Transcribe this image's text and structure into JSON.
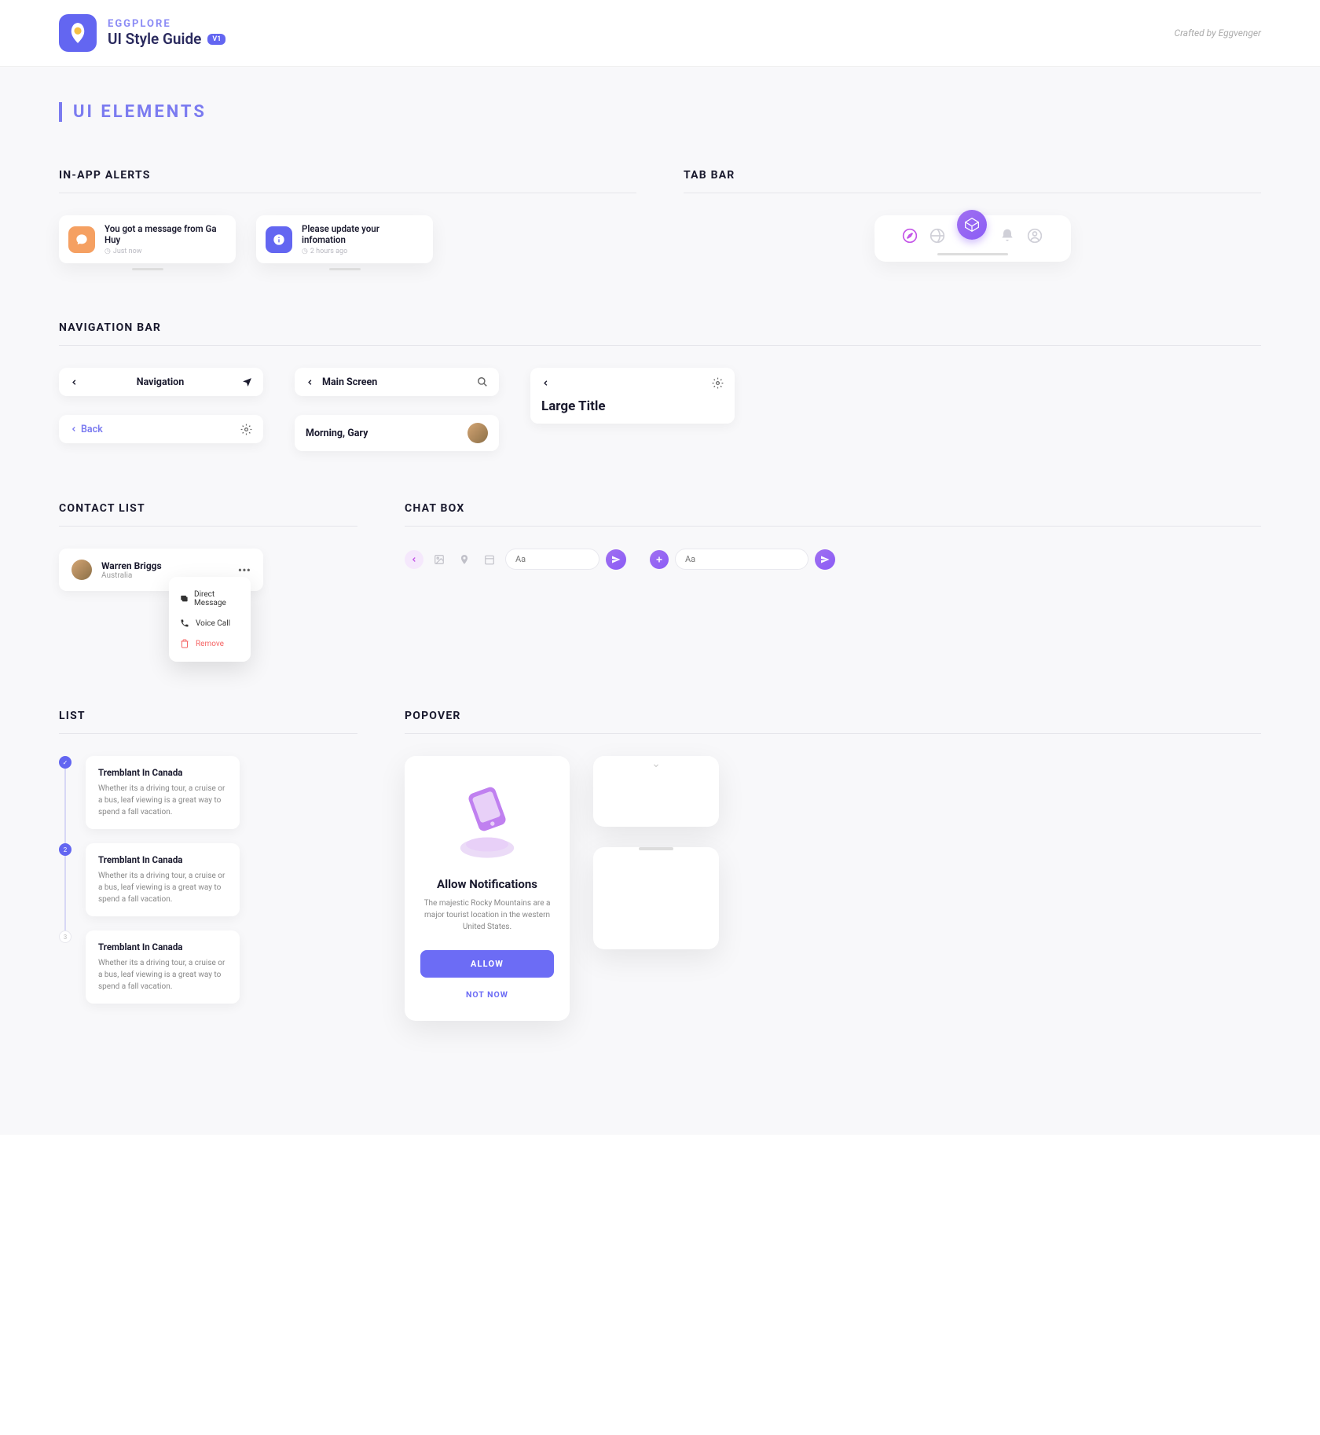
{
  "header": {
    "brand": "EGGPLORE",
    "title": "UI Style Guide",
    "version": "V1",
    "credit": "Crafted by Eggvenger"
  },
  "section_title": "UI ELEMENTS",
  "alerts": {
    "heading": "IN-APP ALERTS",
    "items": [
      {
        "text": "You got a message from Ga Huy",
        "time": "Just now"
      },
      {
        "text": "Please update your infomation",
        "time": "2 hours ago"
      }
    ]
  },
  "tabbar": {
    "heading": "TAB BAR"
  },
  "navbar": {
    "heading": "NAVIGATION BAR",
    "nav1": "Navigation",
    "back": "Back",
    "main": "Main Screen",
    "greeting": "Morning, Gary",
    "large": "Large Title"
  },
  "contact": {
    "heading": "CONTACT LIST",
    "name": "Warren Briggs",
    "location": "Australia",
    "dm": "Direct Message",
    "vc": "Voice Call",
    "rm": "Remove"
  },
  "chatbox": {
    "heading": "CHAT BOX",
    "placeholder": "Aa"
  },
  "list": {
    "heading": "LIST",
    "items": [
      {
        "title": "Tremblant In Canada",
        "desc": "Whether its a driving tour, a cruise or a bus, leaf viewing is a great way to spend a fall vacation.",
        "marker": "✓"
      },
      {
        "title": "Tremblant In Canada",
        "desc": "Whether its a driving tour, a cruise or a bus, leaf viewing is a great way to spend a fall vacation.",
        "marker": "2"
      },
      {
        "title": "Tremblant In Canada",
        "desc": "Whether its a driving tour, a cruise or a bus, leaf viewing is a great way to spend a fall vacation.",
        "marker": "3"
      }
    ]
  },
  "popover": {
    "heading": "POPOVER",
    "title": "Allow Notifications",
    "desc": "The majestic Rocky Mountains are a major tourist location in the western United States.",
    "allow": "ALLOW",
    "notnow": "NOT NOW"
  }
}
